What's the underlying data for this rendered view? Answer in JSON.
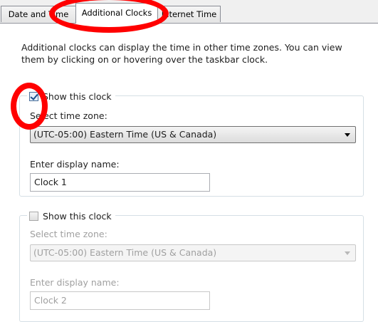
{
  "tabs": [
    "Date and Time",
    "Additional Clocks",
    "Internet Time"
  ],
  "description": "Additional clocks can display the time in other time zones. You can view them by clicking on or hovering over the taskbar clock.",
  "clock1": {
    "show_label": "Show this clock",
    "checked": true,
    "timezone_label": "Select time zone:",
    "timezone_value": "(UTC-05:00) Eastern Time (US & Canada)",
    "name_label": "Enter display name:",
    "name_value": "Clock 1"
  },
  "clock2": {
    "show_label": "Show this clock",
    "checked": false,
    "timezone_label": "Select time zone:",
    "timezone_value": "(UTC-05:00) Eastern Time (US & Canada)",
    "name_label": "Enter display name:",
    "name_value": "Clock 2"
  },
  "colors": {
    "annotation": "#ff0000",
    "tab_border": "#898c95",
    "group_border": "#d5dfe5",
    "disabled_text": "#a0a0a0"
  }
}
